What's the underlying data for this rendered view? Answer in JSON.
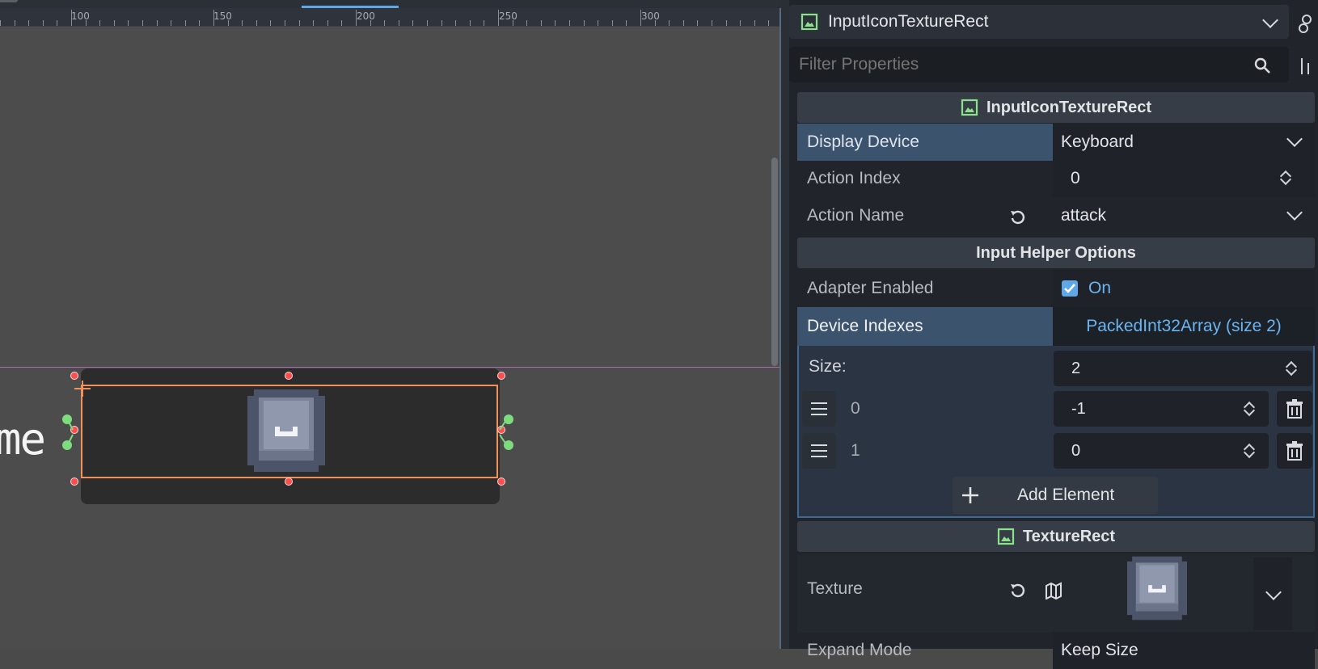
{
  "ruler": {
    "labels": [
      "100",
      "150",
      "200",
      "250",
      "300"
    ]
  },
  "canvas": {
    "partial_text": "me"
  },
  "inspector": {
    "node_name": "InputIconTextureRect",
    "filter_placeholder": "Filter Properties",
    "sections": {
      "script_class": "InputIconTextureRect",
      "helper_options": "Input Helper Options",
      "texture_rect": "TextureRect"
    },
    "properties": {
      "display_device": {
        "label": "Display Device",
        "value": "Keyboard"
      },
      "action_index": {
        "label": "Action Index",
        "value": "0"
      },
      "action_name": {
        "label": "Action Name",
        "value": "attack"
      },
      "adapter_enabled": {
        "label": "Adapter Enabled",
        "value": "On",
        "checked": true
      },
      "device_indexes": {
        "label": "Device Indexes",
        "value": "PackedInt32Array (size 2)"
      },
      "size": {
        "label": "Size:",
        "value": "2"
      },
      "elements": [
        {
          "index": "0",
          "value": "-1"
        },
        {
          "index": "1",
          "value": "0"
        }
      ],
      "add_element": "Add Element",
      "texture": {
        "label": "Texture"
      },
      "expand_mode": {
        "label": "Expand Mode",
        "value": "Keep Size"
      }
    }
  },
  "colors": {
    "accent": "#5fa8e8",
    "selection": "#f0925a",
    "handle": "#ff4d4d",
    "anchor": "#7ddc7d",
    "node_icon": "#8be28b"
  },
  "icons": [
    "texture-rect-icon",
    "chevron-down-icon",
    "search-icon",
    "reset-icon",
    "checkbox-icon",
    "grip-icon",
    "trash-icon",
    "plus-icon",
    "map-icon",
    "keycap-icon"
  ]
}
